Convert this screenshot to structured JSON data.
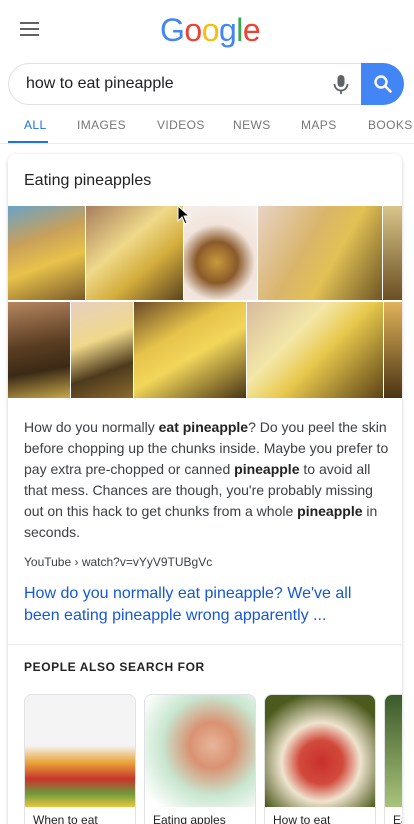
{
  "header": {
    "menu_icon": "hamburger-menu-icon",
    "logo": [
      "G",
      "o",
      "o",
      "g",
      "l",
      "e"
    ],
    "logo_colors": [
      "#4285f4",
      "#ea4335",
      "#fbbc05",
      "#4285f4",
      "#34a853",
      "#ea4335"
    ]
  },
  "search": {
    "query": "how to eat pineapple",
    "mic_icon": "microphone-icon",
    "search_icon": "search-icon",
    "accent": "#4285f4"
  },
  "tabs": [
    "ALL",
    "IMAGES",
    "VIDEOS",
    "NEWS",
    "MAPS",
    "BOOKS"
  ],
  "active_tab": "ALL",
  "result_card": {
    "title": "Eating pineapples",
    "snippet_parts": [
      {
        "t": "How do you normally ",
        "b": false
      },
      {
        "t": "eat pineapple",
        "b": true
      },
      {
        "t": "? Do you peel the skin before chopping up the chunks inside. Maybe you prefer to pay extra pre-chopped or canned ",
        "b": false
      },
      {
        "t": "pineapple",
        "b": true
      },
      {
        "t": " to avoid all that mess. Chances are though, you're probably missing out on this hack to get chunks from a whole ",
        "b": false
      },
      {
        "t": "pineapple",
        "b": true
      },
      {
        "t": " in seconds.",
        "b": false
      }
    ],
    "source": "YouTube › watch?v=vYyV9TUBgVc",
    "link_text": "How do you normally eat pineapple? We've all been eating pineapple wrong apparently ..."
  },
  "people_also_search": {
    "heading": "PEOPLE ALSO SEARCH FOR",
    "items": [
      {
        "label": "When to eat"
      },
      {
        "label": "Eating apples"
      },
      {
        "label": "How to eat"
      },
      {
        "label": "Eat"
      }
    ]
  }
}
